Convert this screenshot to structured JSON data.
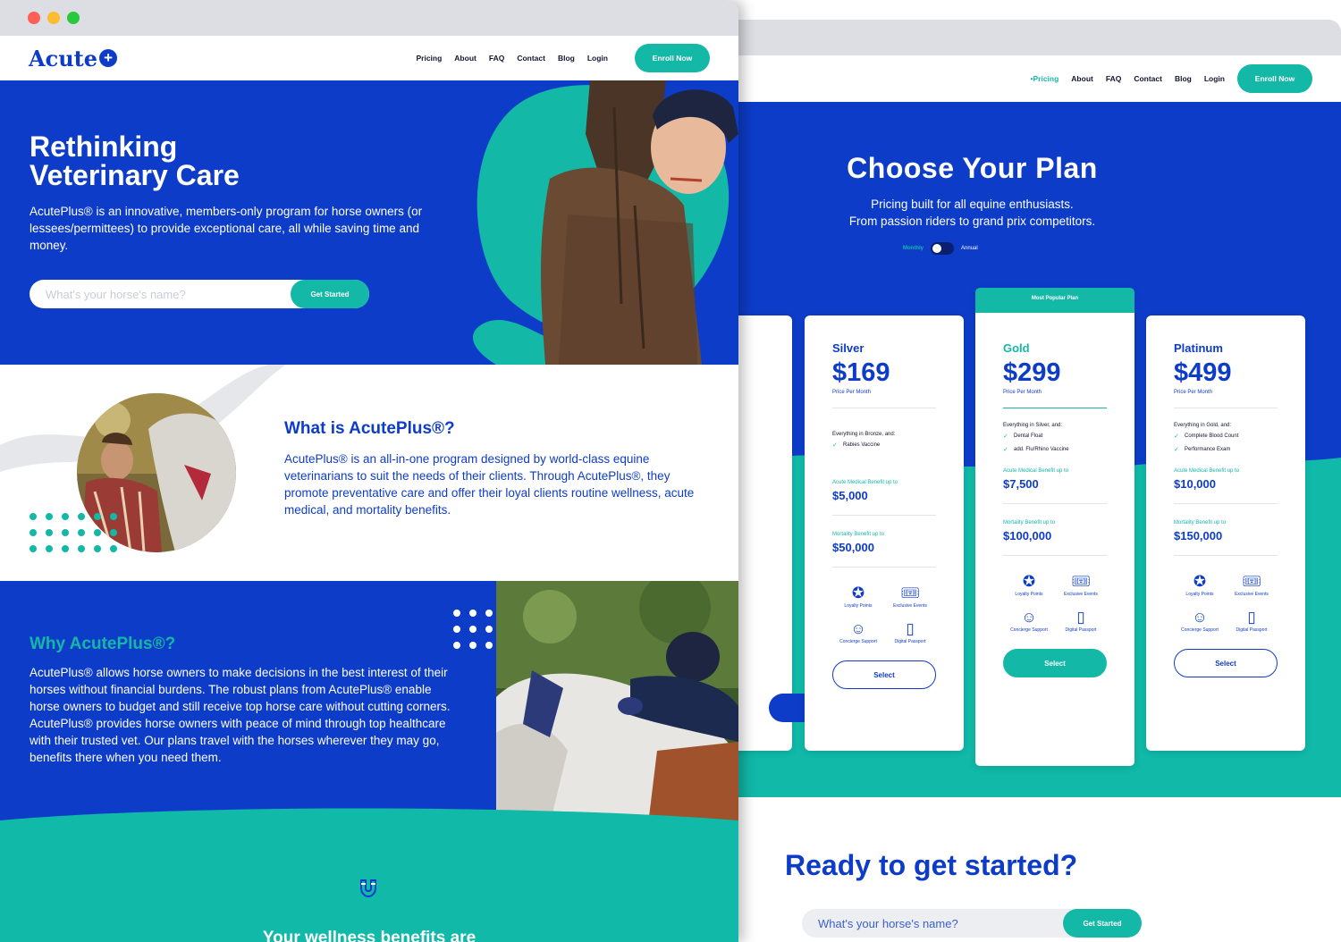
{
  "front": {
    "window_controls": {
      "close_color": "#ff5f57",
      "minimize_color": "#febc2e",
      "zoom_color": "#28c840"
    },
    "logo": {
      "text": "Acute",
      "mark": "+"
    },
    "nav": [
      {
        "label": "Pricing"
      },
      {
        "label": "About"
      },
      {
        "label": "FAQ"
      },
      {
        "label": "Contact"
      },
      {
        "label": "Blog"
      },
      {
        "label": "Login"
      }
    ],
    "enroll_label": "Enroll Now",
    "hero": {
      "title_line1": "Rethinking",
      "title_line2": "Veterinary Care",
      "body": "AcutePlus® is an innovative, members-only program for horse owners (or lessees/permittees) to provide exceptional care, all while saving time and money.",
      "input_placeholder": "What's your horse's name?",
      "cta": "Get Started"
    },
    "what": {
      "title": "What is AcutePlus®?",
      "body": "AcutePlus®  is an all-in-one program designed by world-class equine veterinarians to suit the needs of their clients. Through AcutePlus®, they promote preventative care and offer their loyal clients routine wellness, acute medical, and mortality benefits."
    },
    "why": {
      "title": "Why AcutePlus®?",
      "body": "AcutePlus® allows horse owners to make decisions in the best interest of their horses without financial burdens. The robust plans from AcutePlus® enable horse owners to budget and still receive top horse care without cutting corners. AcutePlus®  provides horse owners with peace of mind through top healthcare with their trusted vet. Our plans travel with the horses wherever they may go, benefits there when you need them."
    },
    "wellness": {
      "title": "Your wellness benefits are"
    }
  },
  "back": {
    "nav": [
      {
        "label": "•Pricing"
      },
      {
        "label": "About"
      },
      {
        "label": "FAQ"
      },
      {
        "label": "Contact"
      },
      {
        "label": "Blog"
      },
      {
        "label": "Login"
      }
    ],
    "enroll_label": "Enroll Now",
    "title": "Choose Your Plan",
    "subtitle_line1": "Pricing built for all equine enthusiasts.",
    "subtitle_line2": "From passion riders to grand prix competitors.",
    "toggle": {
      "monthly": "Monthly",
      "annual": "Annual",
      "selected": "Monthly"
    },
    "popular_label": "Most Popular Plan",
    "price_period": "Price Per Month",
    "medical_label": "Acute Medical Benefit up to",
    "mortality_label": "Mortality Benefit up to",
    "perks": [
      "Loyalty Points",
      "Exclusive Events",
      "Concierge Support",
      "Digital Passport"
    ],
    "select_label": "Select",
    "plans": [
      {
        "name": "Silver",
        "price": "$169",
        "everything": "Everything in Bronze, and:",
        "features": [
          "Rabies Vaccine"
        ],
        "medical": "$5,000",
        "mortality": "$50,000"
      },
      {
        "name": "Gold",
        "price": "$299",
        "everything": "Everything in Silver, and:",
        "features": [
          "Dental Float",
          "add. Flu/Rhino Vaccine"
        ],
        "medical": "$7,500",
        "mortality": "$100,000"
      },
      {
        "name": "Platinum",
        "price": "$499",
        "everything": "Everything in Gold, and:",
        "features": [
          "Complete Blood Count",
          "Performance Exam"
        ],
        "medical": "$10,000",
        "mortality": "$150,000"
      }
    ],
    "ready": {
      "title": "Ready to get started?",
      "input_placeholder": "What's your horse's name?",
      "cta": "Get Started"
    },
    "colors": {
      "blue": "#0d3cc8",
      "teal": "#14b8a6"
    }
  }
}
